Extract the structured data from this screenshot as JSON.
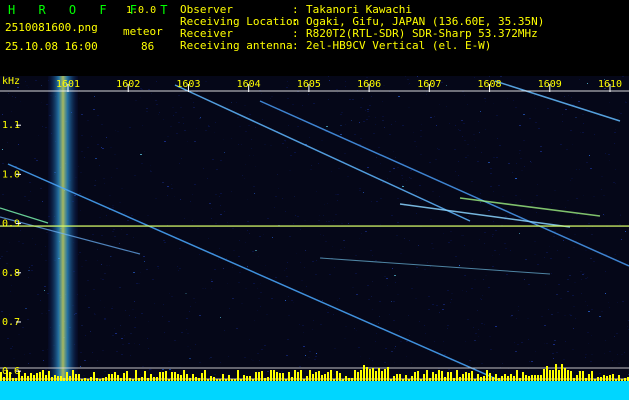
{
  "app": {
    "title": "H R O F F T",
    "version": "1.0.0"
  },
  "file": {
    "name": "2510081600.png",
    "datetime": "25.10.08 16:00",
    "type_label": "meteor",
    "count": "86"
  },
  "info": {
    "rows": [
      {
        "label": "Observer",
        "sep": ":",
        "value": "Takanori Kawachi"
      },
      {
        "label": "Receiving Location",
        "sep": ":",
        "value": "Ogaki, Gifu, JAPAN (136.60E, 35.35N)"
      },
      {
        "label": "Receiver",
        "sep": ":",
        "value": "R820T2(RTL-SDR) SDR-Sharp 53.372MHz"
      },
      {
        "label": "Receiving antenna",
        "sep": ":",
        "value": "2el-HB9CV Vertical (el. E-W)"
      }
    ]
  },
  "spectrogram": {
    "y_unit": "kHz",
    "time_ticks": [
      "1601",
      "1602",
      "1603",
      "1604",
      "1605",
      "1606",
      "1607",
      "1608",
      "1609",
      "1610"
    ],
    "freq_ticks": [
      "1.1",
      "1.0",
      "0.9",
      "0.8",
      "0.7",
      "0.6"
    ],
    "freq_range_khz": [
      0.58,
      1.2
    ],
    "carrier_khz": 0.895,
    "colors": {
      "axis_text": "#ffff00",
      "header_text": "#00ff00",
      "background": "#000000",
      "noise_dark": "#070d2c",
      "trace": "#5aa8ff",
      "carrier": "#c8ff66",
      "band": "#00d7ff"
    }
  }
}
